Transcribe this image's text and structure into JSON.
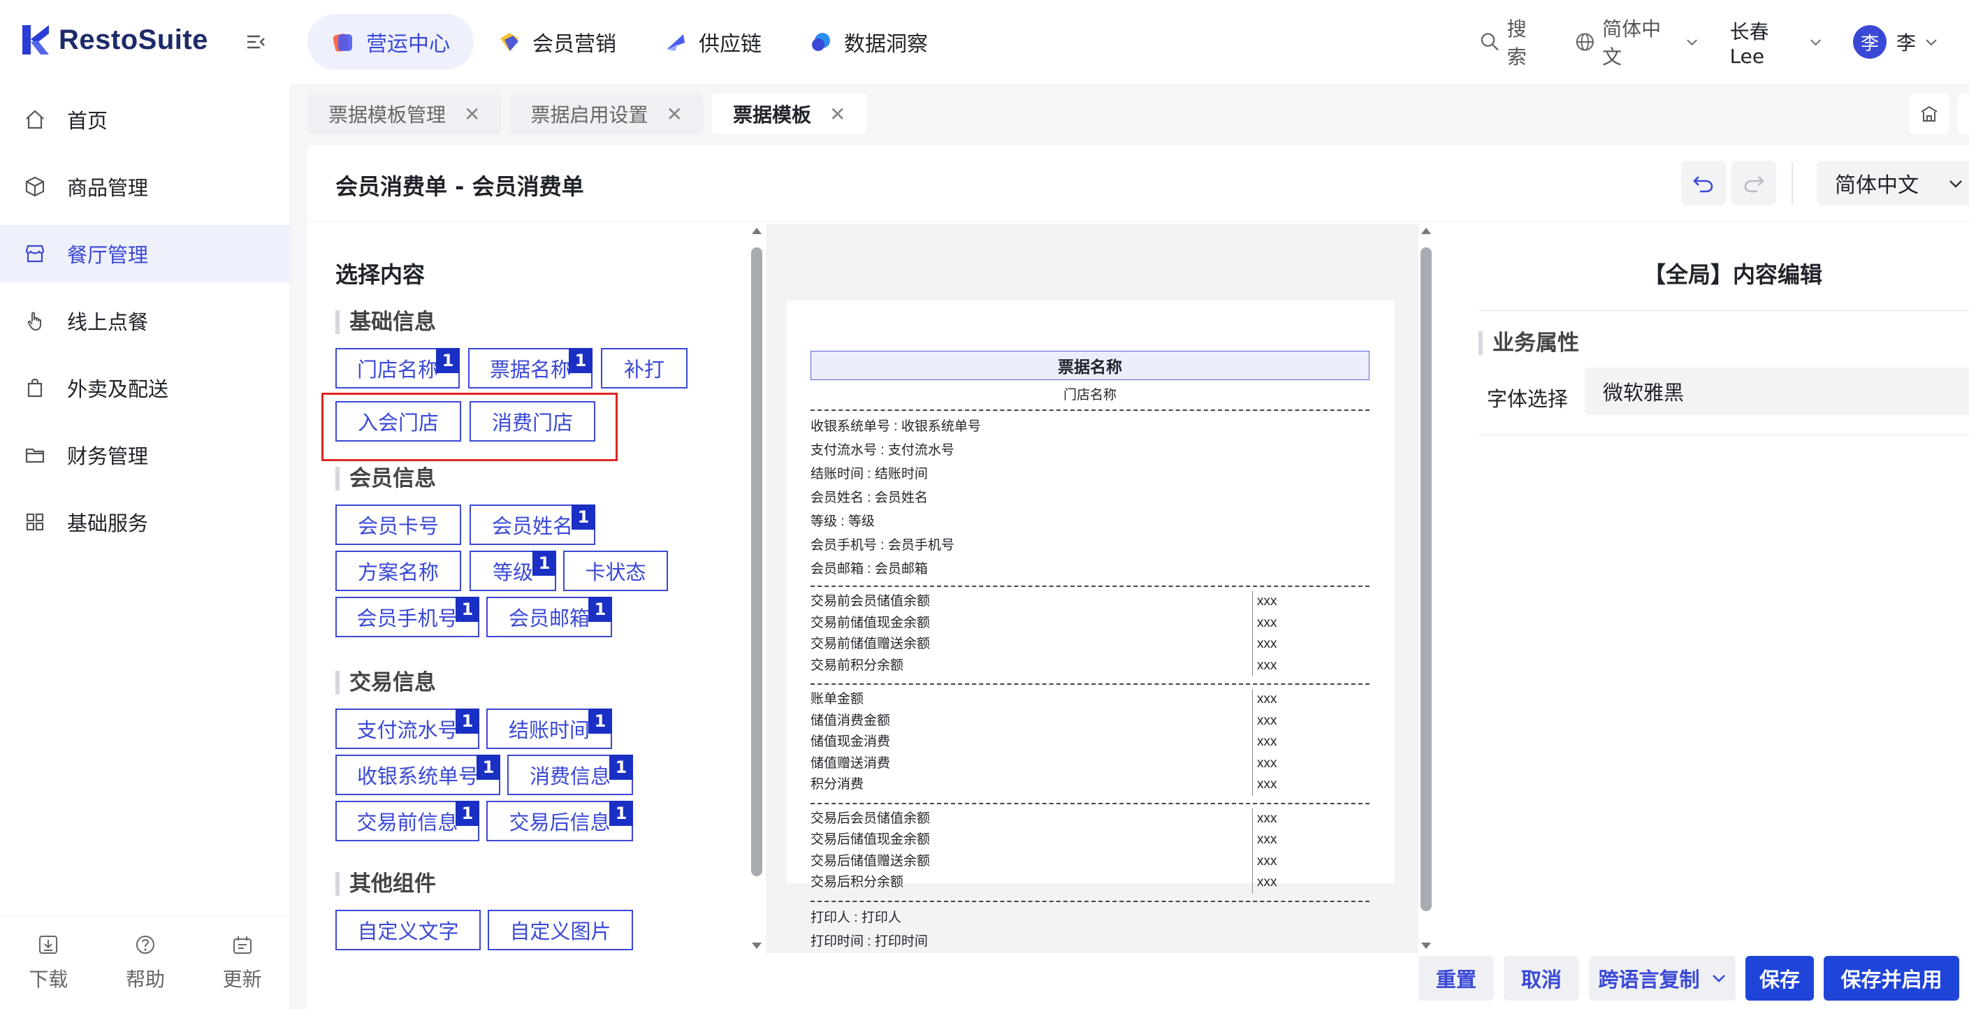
{
  "app": {
    "brand": "RestoSuite"
  },
  "topnav": [
    {
      "label": "营运中心",
      "icon": "operations-icon",
      "active": true
    },
    {
      "label": "会员营销",
      "icon": "membership-icon",
      "active": false
    },
    {
      "label": "供应链",
      "icon": "supply-chain-icon",
      "active": false
    },
    {
      "label": "数据洞察",
      "icon": "data-insight-icon",
      "active": false
    }
  ],
  "topright": {
    "search": "搜索",
    "language": "简体中文",
    "location": "长春Lee",
    "avatar_text": "李",
    "user_name": "李"
  },
  "sidebar": {
    "items": [
      {
        "label": "首页",
        "icon": "home-icon"
      },
      {
        "label": "商品管理",
        "icon": "product-icon"
      },
      {
        "label": "餐厅管理",
        "icon": "store-icon"
      },
      {
        "label": "线上点餐",
        "icon": "hand-tap-icon"
      },
      {
        "label": "外卖及配送",
        "icon": "bag-icon"
      },
      {
        "label": "财务管理",
        "icon": "folder-icon"
      },
      {
        "label": "基础服务",
        "icon": "grid-icon"
      }
    ],
    "footer": [
      {
        "label": "下载",
        "icon": "download-icon"
      },
      {
        "label": "帮助",
        "icon": "help-icon"
      },
      {
        "label": "更新",
        "icon": "update-icon"
      }
    ]
  },
  "tabs": [
    {
      "label": "票据模板管理"
    },
    {
      "label": "票据启用设置"
    },
    {
      "label": "票据模板"
    }
  ],
  "page": {
    "title": "会员消费单 - 会员消费单",
    "language": "简体中文"
  },
  "left": {
    "title": "选择内容",
    "groups": {
      "basic": {
        "title": "基础信息",
        "chips": [
          {
            "label": "门店名称",
            "count": "1"
          },
          {
            "label": "票据名称",
            "count": "1"
          },
          {
            "label": "补打",
            "count": ""
          },
          {
            "label": "入会门店",
            "count": ""
          },
          {
            "label": "消费门店",
            "count": ""
          }
        ]
      },
      "member": {
        "title": "会员信息",
        "chips": [
          {
            "label": "会员卡号",
            "count": ""
          },
          {
            "label": "会员姓名",
            "count": "1"
          },
          {
            "label": "方案名称",
            "count": ""
          },
          {
            "label": "等级",
            "count": "1"
          },
          {
            "label": "卡状态",
            "count": ""
          },
          {
            "label": "会员手机号",
            "count": "1"
          },
          {
            "label": "会员邮箱",
            "count": "1"
          }
        ]
      },
      "trade": {
        "title": "交易信息",
        "chips": [
          {
            "label": "支付流水号",
            "count": "1"
          },
          {
            "label": "结账时间",
            "count": "1"
          },
          {
            "label": "收银系统单号",
            "count": "1"
          },
          {
            "label": "消费信息",
            "count": "1"
          },
          {
            "label": "交易前信息",
            "count": "1"
          },
          {
            "label": "交易后信息",
            "count": "1"
          }
        ]
      },
      "other": {
        "title": "其他组件",
        "chips": [
          {
            "label": "自定义文字",
            "count": ""
          },
          {
            "label": "自定义图片",
            "count": ""
          }
        ]
      }
    }
  },
  "receipt": {
    "title": "票据名称",
    "store": "门店名称",
    "info_lines": [
      "收银系统单号 : 收银系统单号",
      "支付流水号 : 支付流水号",
      "结账时间 : 结账时间",
      "会员姓名 : 会员姓名",
      "等级 : 等级",
      "会员手机号 : 会员手机号",
      "会员邮箱 : 会员邮箱"
    ],
    "before": [
      {
        "label": "交易前会员储值余额",
        "value": "xxx"
      },
      {
        "label": "交易前储值现金余额",
        "value": "xxx"
      },
      {
        "label": "交易前储值赠送余额",
        "value": "xxx"
      },
      {
        "label": "交易前积分余额",
        "value": "xxx"
      }
    ],
    "consume": [
      {
        "label": "账单金额",
        "value": "xxx"
      },
      {
        "label": "储值消费金额",
        "value": "xxx"
      },
      {
        "label": "储值现金消费",
        "value": "xxx"
      },
      {
        "label": "储值赠送消费",
        "value": "xxx"
      },
      {
        "label": "积分消费",
        "value": "xxx"
      }
    ],
    "after": [
      {
        "label": "交易后会员储值余额",
        "value": "xxx"
      },
      {
        "label": "交易后储值现金余额",
        "value": "xxx"
      },
      {
        "label": "交易后储值赠送余额",
        "value": "xxx"
      },
      {
        "label": "交易后积分余额",
        "value": "xxx"
      }
    ],
    "footer_lines": [
      "打印人 : 打印人",
      "打印时间 : 打印时间"
    ]
  },
  "right": {
    "title": "【全局】内容编辑",
    "group": "业务属性",
    "font_label": "字体选择",
    "font_value": "微软雅黑"
  },
  "actions": {
    "reset": "重置",
    "cancel": "取消",
    "copy": "跨语言复制",
    "save": "保存",
    "save_enable": "保存并启用"
  },
  "colors": {
    "accent": "#3a48d6",
    "primary_button": "#1f44d8",
    "highlight_border": "#e02424",
    "count_badge": "#1a2fc4"
  }
}
